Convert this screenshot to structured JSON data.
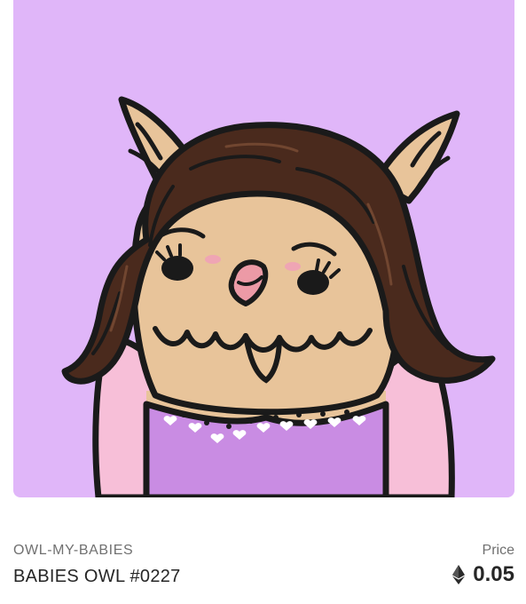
{
  "nft": {
    "image_alt": "Babies Owl artwork",
    "background_color": "#e0b6f9",
    "collection": "OWL-MY-BABIES",
    "name": "BABIES OWL #0227",
    "price_label": "Price",
    "price_value": "0.05",
    "currency_icon": "ethereum-icon"
  }
}
